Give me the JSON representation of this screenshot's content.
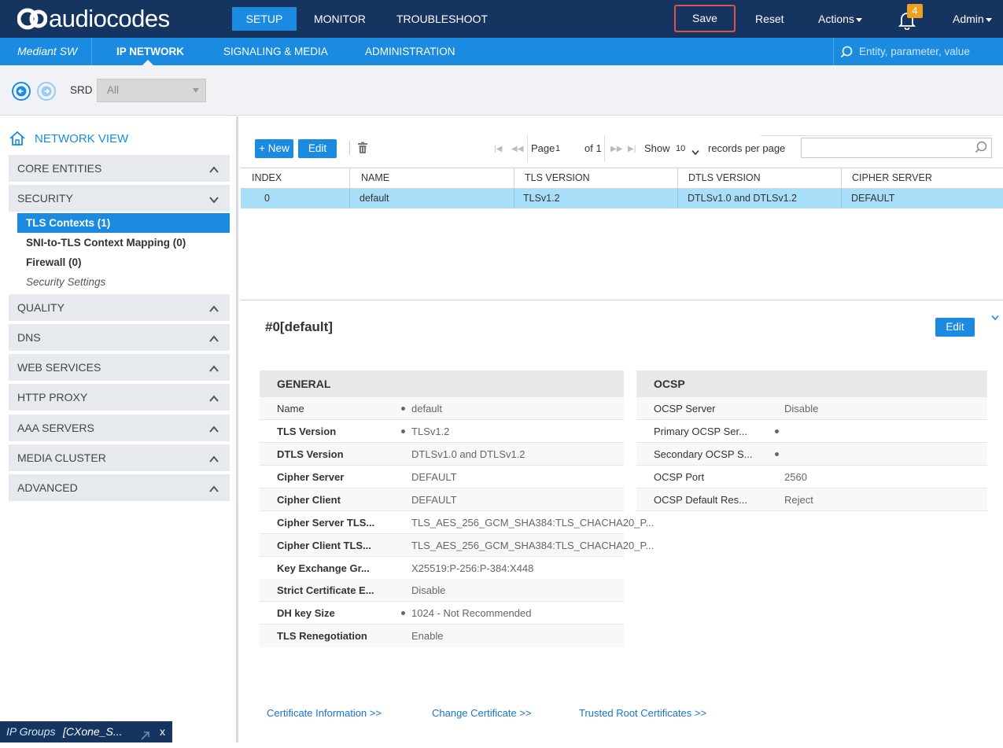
{
  "header": {
    "logo_text": "audiocodes",
    "nav": {
      "setup": "SETUP",
      "monitor": "MONITOR",
      "troubleshoot": "TROUBLESHOOT"
    },
    "save_label": "Save",
    "reset_label": "Reset",
    "actions_label": "Actions",
    "notifications_count": "4",
    "admin_label": "Admin"
  },
  "subnav": {
    "product": "Mediant SW",
    "tabs": {
      "ip_network": "IP NETWORK",
      "signaling": "SIGNALING & MEDIA",
      "administration": "ADMINISTRATION"
    },
    "search_placeholder": "Entity, parameter, value"
  },
  "toolbar": {
    "srd_label": "SRD",
    "srd_value": "All"
  },
  "sidebar": {
    "title": "NETWORK VIEW",
    "sections": {
      "core": "CORE ENTITIES",
      "security": "SECURITY",
      "quality": "QUALITY",
      "dns": "DNS",
      "web": "WEB SERVICES",
      "http": "HTTP PROXY",
      "aaa": "AAA SERVERS",
      "media": "MEDIA CLUSTER",
      "advanced": "ADVANCED"
    },
    "security_items": {
      "tls": "TLS Contexts (1)",
      "sni": "SNI-to-TLS Context Mapping (0)",
      "firewall": "Firewall (0)",
      "settings": "Security Settings"
    }
  },
  "table": {
    "new_label": "+ New",
    "edit_label": "Edit",
    "pager": {
      "page_label": "Page",
      "page_value": "1",
      "of_label": "of 1",
      "show_label": "Show",
      "per_page_value": "10",
      "records_label": "records per page"
    },
    "columns": {
      "index": "INDEX",
      "name": "NAME",
      "tls": "TLS VERSION",
      "dtls": "DTLS VERSION",
      "cipher": "CIPHER SERVER"
    },
    "row": {
      "index": "0",
      "name": "default",
      "tls": "TLSv1.2",
      "dtls": "DTLSv1.0 and DTLSv1.2",
      "cipher": "DEFAULT"
    }
  },
  "detail": {
    "title": "#0[default]",
    "edit_label": "Edit",
    "general": {
      "header": "GENERAL",
      "rows": [
        {
          "label": "Name",
          "value": "default"
        },
        {
          "label": "TLS Version",
          "value": "TLSv1.2"
        },
        {
          "label": "DTLS Version",
          "value": "DTLSv1.0 and DTLSv1.2"
        },
        {
          "label": "Cipher Server",
          "value": "DEFAULT"
        },
        {
          "label": "Cipher Client",
          "value": "DEFAULT"
        },
        {
          "label": "Cipher Server TLS...",
          "value": "TLS_AES_256_GCM_SHA384:TLS_CHACHA20_P..."
        },
        {
          "label": "Cipher Client TLS...",
          "value": "TLS_AES_256_GCM_SHA384:TLS_CHACHA20_P..."
        },
        {
          "label": "Key Exchange Gr...",
          "value": "X25519:P-256:P-384:X448"
        },
        {
          "label": "Strict Certificate E...",
          "value": "Disable"
        },
        {
          "label": "DH key Size",
          "value": "1024 - Not Recommended"
        },
        {
          "label": "TLS Renegotiation",
          "value": "Enable"
        }
      ]
    },
    "ocsp": {
      "header": "OCSP",
      "rows": [
        {
          "label": "OCSP Server",
          "value": "Disable"
        },
        {
          "label": "Primary OCSP Ser...",
          "value": ""
        },
        {
          "label": "Secondary OCSP S...",
          "value": ""
        },
        {
          "label": "OCSP Port",
          "value": "2560"
        },
        {
          "label": "OCSP Default Res...",
          "value": "Reject"
        }
      ]
    },
    "links": {
      "cert_info": "Certificate Information  >>",
      "change_cert": "Change Certificate  >>",
      "trusted_root": "Trusted Root Certificates  >>"
    }
  },
  "taskbar": {
    "label": "IP Groups",
    "value": "[CXone_S...",
    "close": "x"
  },
  "colors": {
    "navy": "#15345f",
    "accent": "#1a8be0",
    "selected_row": "#a8dff8",
    "save_outline": "#d9534f"
  }
}
